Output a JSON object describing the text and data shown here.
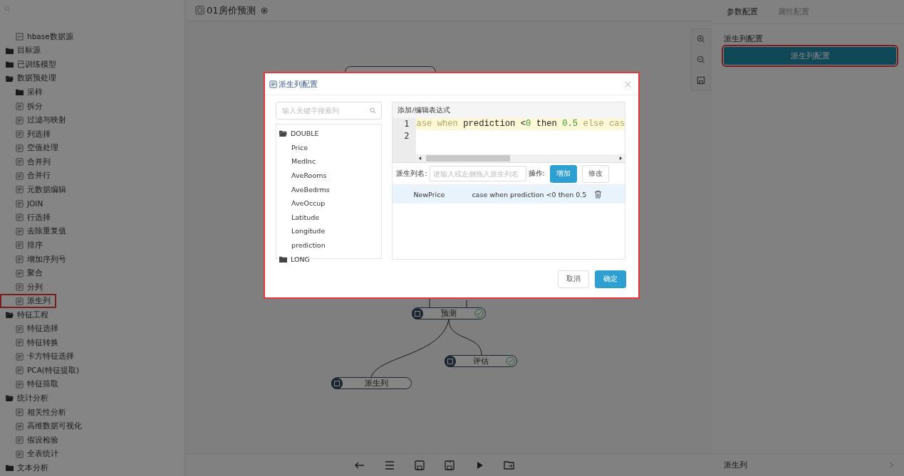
{
  "sidebar": {
    "partial_children": [
      {
        "label": "hbase数据源",
        "selected": false
      }
    ],
    "items": [
      {
        "label": "目标源",
        "expanded": false,
        "selected": false
      },
      {
        "label": "已训练模型",
        "expanded": false,
        "selected": false
      },
      {
        "label": "数据预处理",
        "expanded": true,
        "selected": false,
        "children": [
          {
            "label": "采样",
            "kind": "folder",
            "expanded": false,
            "selected": false
          },
          {
            "label": "拆分",
            "kind": "item",
            "selected": false
          },
          {
            "label": "过滤与映射",
            "kind": "item",
            "selected": false
          },
          {
            "label": "列选择",
            "kind": "item",
            "selected": false
          },
          {
            "label": "空值处理",
            "kind": "item",
            "selected": false
          },
          {
            "label": "合并列",
            "kind": "item",
            "selected": false
          },
          {
            "label": "合并行",
            "kind": "item",
            "selected": false
          },
          {
            "label": "元数据编辑",
            "kind": "item",
            "selected": false
          },
          {
            "label": "JOIN",
            "kind": "item",
            "selected": false
          },
          {
            "label": "行选择",
            "kind": "item",
            "selected": false
          },
          {
            "label": "去除重复值",
            "kind": "item",
            "selected": false
          },
          {
            "label": "排序",
            "kind": "item",
            "selected": false
          },
          {
            "label": "增加序列号",
            "kind": "item",
            "selected": false
          },
          {
            "label": "聚合",
            "kind": "item",
            "selected": false
          },
          {
            "label": "分列",
            "kind": "item",
            "selected": false
          },
          {
            "label": "派生列",
            "kind": "item",
            "selected": true
          }
        ]
      },
      {
        "label": "特征工程",
        "expanded": true,
        "selected": false,
        "children": [
          {
            "label": "特征选择",
            "kind": "item",
            "selected": false
          },
          {
            "label": "特征转换",
            "kind": "item",
            "selected": false
          },
          {
            "label": "卡方特征选择",
            "kind": "item",
            "selected": false
          },
          {
            "label": "PCA(特征提取)",
            "kind": "item",
            "selected": false
          },
          {
            "label": "特征筛取",
            "kind": "item",
            "selected": false
          }
        ]
      },
      {
        "label": "统计分析",
        "expanded": true,
        "selected": false,
        "children": [
          {
            "label": "相关性分析",
            "kind": "item",
            "selected": false
          },
          {
            "label": "高维数据可视化",
            "kind": "item",
            "selected": false
          },
          {
            "label": "假设检验",
            "kind": "item",
            "selected": false
          },
          {
            "label": "全表统计",
            "kind": "item",
            "selected": false
          }
        ]
      },
      {
        "label": "文本分析",
        "expanded": false,
        "selected": false
      }
    ]
  },
  "header": {
    "title": "01房价预测"
  },
  "canvas": {
    "nodes": [
      {
        "label": "预测",
        "done": true
      },
      {
        "label": "评估",
        "done": true
      },
      {
        "label": "派生列",
        "done": false
      }
    ]
  },
  "right_panel": {
    "tabs": [
      {
        "label": "参数配置",
        "selected": true
      },
      {
        "label": "属性配置",
        "selected": false
      }
    ],
    "section_label": "派生列配置",
    "config_button": {
      "label": "派生列配置",
      "highlighted": true
    },
    "footer": {
      "label": "派生列"
    }
  },
  "dialog": {
    "title": "派生列配置",
    "search": {
      "placeholder": "输入关键字搜索列"
    },
    "column_groups": [
      {
        "label": "DOUBLE",
        "expanded": true,
        "columns": [
          "Price",
          "MedInc",
          "AveRooms",
          "AveBedrms",
          "AveOccup",
          "Latitude",
          "Longitude",
          "prediction"
        ]
      },
      {
        "label": "LONG",
        "expanded": false
      }
    ],
    "editor": {
      "header": "添加/编辑表达式",
      "line_numbers": [
        "1",
        "2"
      ],
      "tokens": [
        {
          "text": "ase when ",
          "kind": "keyword"
        },
        {
          "text": "prediction <",
          "kind": "plain"
        },
        {
          "text": "0",
          "kind": "number"
        },
        {
          "text": " then ",
          "kind": "plain"
        },
        {
          "text": "0.5",
          "kind": "number"
        },
        {
          "text": " else ",
          "kind": "keyword"
        },
        {
          "text": "cas",
          "kind": "keyword"
        }
      ]
    },
    "name_label": "派生列名:",
    "name_input": {
      "placeholder": "请输入或左侧拖入派生列名"
    },
    "operation_label": "操作:",
    "buttons": [
      {
        "label": "增加",
        "kind": "primary"
      },
      {
        "label": "修改",
        "kind": "default"
      }
    ],
    "rows": [
      {
        "name": "NewPrice",
        "expression": "case when prediction <0 then 0.5",
        "selected": true
      }
    ],
    "footer_buttons": [
      {
        "label": "取消",
        "kind": "default"
      },
      {
        "label": "确定",
        "kind": "primary"
      }
    ]
  }
}
